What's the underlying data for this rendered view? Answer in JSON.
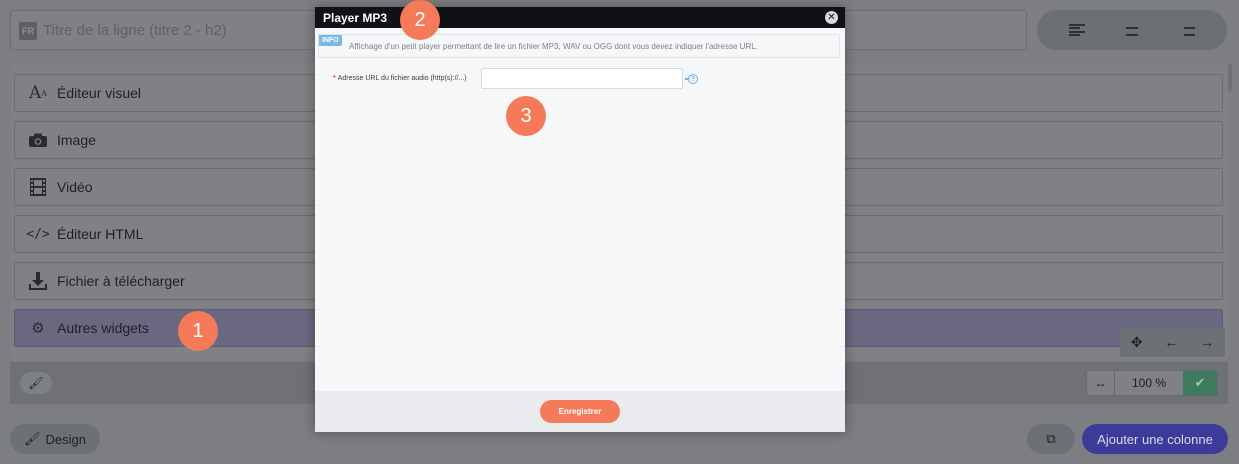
{
  "background": {
    "title_field": {
      "lang_badge": "FR",
      "placeholder": "Titre de la ligne (titre 2 - h2)"
    },
    "widgets": [
      {
        "label": "Éditeur visuel",
        "icon": "font-size-icon"
      },
      {
        "label": "Image",
        "icon": "camera-icon"
      },
      {
        "label": "Vidéo",
        "icon": "film-icon"
      },
      {
        "label": "Éditeur HTML",
        "icon": "code-icon"
      },
      {
        "label": "Fichier à télécharger",
        "icon": "download-icon"
      },
      {
        "label": "Autres widgets",
        "icon": "gears-icon"
      }
    ],
    "width_value": "100 %",
    "design_label": "Design",
    "add_column_label": "Ajouter une colonne"
  },
  "callouts": [
    "1",
    "2",
    "3"
  ],
  "modal": {
    "title": "Player MP3",
    "info_badge": "INFO",
    "info_text": "Affichage d'un petit player permettant de lire un fichier MP3, WAV ou OGG dont vous devez indiquer l'adresse URL.",
    "field_label": "Adresse URL du fichier audio (http(s)://...)",
    "required_mark": "*",
    "field_value": "",
    "save_label": "Enregistrer"
  },
  "colors": {
    "accent": "#f47a5a",
    "primary_button": "#3d3b9a",
    "modal_header": "#0f1117",
    "info_badge": "#7ab8e6"
  }
}
